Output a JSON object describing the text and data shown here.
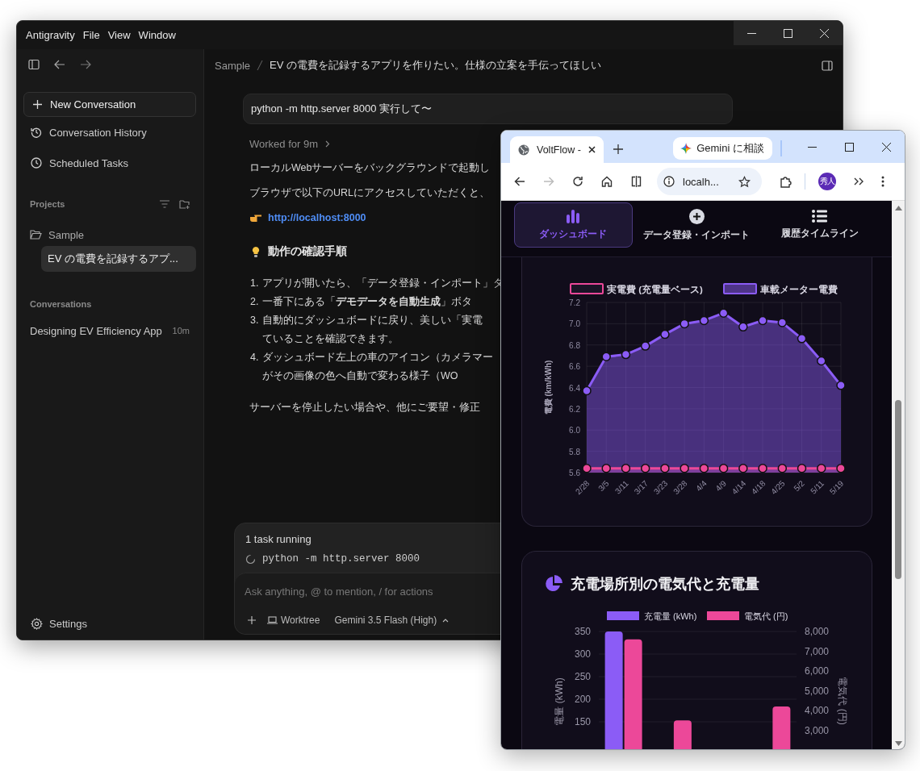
{
  "app_window": {
    "menu": [
      "Antigravity",
      "File",
      "View",
      "Window"
    ],
    "sidebar": {
      "new_conversation": "New Conversation",
      "nav_items": [
        {
          "label": "Conversation History"
        },
        {
          "label": "Scheduled Tasks"
        }
      ],
      "projects_heading": "Projects",
      "projects": [
        {
          "name": "Sample",
          "expanded": true,
          "children": [
            {
              "title": "EV の電費を記録するアプ...",
              "selected": true
            }
          ]
        }
      ],
      "conversations_heading": "Conversations",
      "conversations": [
        {
          "title": "Designing EV Efficiency App",
          "age": "10m",
          "selected": false
        }
      ],
      "settings": "Settings"
    },
    "chat": {
      "breadcrumb": [
        "Sample",
        "EV の電費を記録するアプリを作りたい。仕様の立案を手伝ってほしい"
      ],
      "prompt": "python -m http.server 8000 実行して〜",
      "worked": "Worked for 9m",
      "paragraphs": [
        "ローカルWebサーバーをバックグラウンドで起動し",
        "ブラウザで以下のURLにアクセスしていただくと、"
      ],
      "link": "http://localhost:8000",
      "heading": "動作の確認手順",
      "steps": [
        {
          "number": "1.",
          "lines": [
            "アプリが開いたら、「データ登録・インポート」タ"
          ]
        },
        {
          "number": "2.",
          "lines": [
            "一番下にある「**デモデータを自動生成**」ボタ"
          ]
        },
        {
          "number": "3.",
          "lines": [
            "自動的にダッシュボードに戻り、美しい「実電",
            "ていることを確認できます。"
          ]
        },
        {
          "number": "4.",
          "lines": [
            "ダッシュボード左上の車のアイコン（カメラマー",
            "がその画像の色へ自動で変わる様子（WO"
          ]
        }
      ],
      "closing": "サーバーを停止したい場合や、他にご要望・修正",
      "tasks": {
        "title": "1 task running",
        "items": [
          "python -m http.server 8000"
        ]
      },
      "composer": {
        "placeholder": "Ask anything, @ to mention, / for actions",
        "worktree": "Worktree",
        "model": "Gemini 3.5 Flash (High)"
      }
    }
  },
  "browser": {
    "tab": {
      "title": "VoltFlow -",
      "selected": true
    },
    "gemini_button": "Gemini に相談",
    "forward_disabled": true,
    "address": "localh...",
    "profile": "秀人",
    "page": {
      "nav": [
        {
          "label": "ダッシュボード",
          "selected": true
        },
        {
          "label": "データ登録・インポート",
          "selected": false
        },
        {
          "label": "履歴タイムライン",
          "selected": false
        }
      ],
      "efficiency_card": {
        "chart_data": {
          "type": "area",
          "ylabel": "電費 (km/kWh)",
          "grid": true,
          "legend": "top",
          "categories": [
            "2/28",
            "3/5",
            "3/11",
            "3/17",
            "3/23",
            "3/28",
            "4/4",
            "4/9",
            "4/14",
            "4/18",
            "4/25",
            "5/2",
            "5/11",
            "5/19"
          ],
          "series": [
            {
              "name": "実電費 (充電量ベース)",
              "color": "#ec4899",
              "marker": "circle",
              "values": [
                5.64,
                5.64,
                5.64,
                5.64,
                5.64,
                5.64,
                5.64,
                5.64,
                5.64,
                5.64,
                5.64,
                5.64,
                5.64,
                5.64
              ]
            },
            {
              "name": "車載メーター電費",
              "color": "#8b5cf6",
              "marker": "circle",
              "values": [
                6.37,
                6.69,
                6.71,
                6.79,
                6.9,
                7.0,
                7.03,
                7.1,
                6.97,
                7.03,
                7.01,
                6.86,
                6.65,
                6.42
              ]
            }
          ],
          "ylim": [
            5.6,
            7.2
          ],
          "yticks": [
            5.6,
            5.8,
            {
              "value": 6,
              "label": "6.0"
            },
            6.2,
            6.4,
            6.6,
            6.8,
            {
              "value": 7,
              "label": "7.0"
            },
            7.2
          ]
        }
      },
      "cost_card": {
        "title": "充電場所別の電気代と充電量",
        "chart_data": {
          "type": "bar",
          "stacked": false,
          "grid": true,
          "legend": "top",
          "ylabel": "電量 (kWh)",
          "y2label": "電気代 (円)",
          "series": [
            {
              "name": "充電量 (kWh)",
              "color": "#8b5cf6",
              "values": [
                350,
                null,
                null,
                null
              ]
            },
            {
              "name": "電気代 (円)",
              "color": "#ec4899",
              "axis": "y2",
              "values": [
                7600,
                3500,
                null,
                4200
              ]
            }
          ],
          "ylim": [
            0,
            350
          ],
          "yticks": [
            150,
            200,
            250,
            300,
            350
          ],
          "y2lim": [
            0,
            8000
          ],
          "y2ticks": [
            {
              "value": 3000,
              "label": "3,000"
            },
            {
              "value": 4000,
              "label": "4,000"
            },
            {
              "value": 5000,
              "label": "5,000"
            },
            {
              "value": 6000,
              "label": "6,000"
            },
            {
              "value": 7000,
              "label": "7,000"
            },
            {
              "value": 8000,
              "label": "8,000"
            }
          ]
        }
      }
    }
  }
}
